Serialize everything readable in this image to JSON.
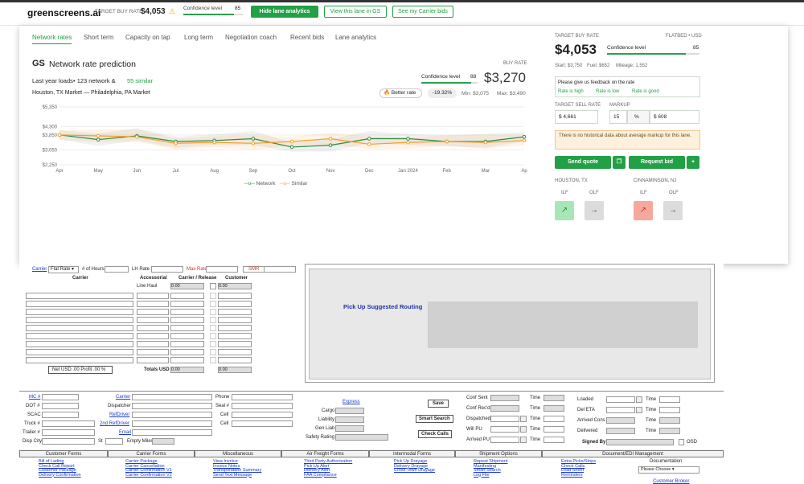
{
  "topbar": {
    "logo": "greenscreens.ai",
    "target_buy_rate_label": "TARGET BUY RATE",
    "target_buy_rate": "$4,053",
    "confidence_label": "Confidence level",
    "confidence": "85",
    "hide_btn": "Hide lane analytics",
    "view_btn": "View this lane in GS",
    "carrier_btn": "See my Carrier bids"
  },
  "tabs": [
    "Network rates",
    "Short term",
    "Capacity on tap",
    "Long term",
    "Negotiation coach",
    "Recent bids",
    "Lane analytics"
  ],
  "prediction": {
    "title": "Network rate prediction",
    "gs": "GS",
    "buy_rate_label": "BUY RATE",
    "last_year": "Last year loads",
    "network_count": "• 123 network &",
    "similar": "55 similar",
    "confidence_label": "Confidence level",
    "confidence": "88",
    "rate": "$3,270",
    "lane": "Houston, TX Market — Philadelphia, PA Market",
    "better_rate": "Better rate",
    "pct": "-19.32%",
    "min": "Min: $3,075",
    "max": "Max: $3,490"
  },
  "chart_data": {
    "type": "line",
    "categories": [
      "Apr",
      "May",
      "Jun",
      "Jul",
      "Aug",
      "Sep",
      "Oct",
      "Nov",
      "Dec",
      "Jan 2024",
      "Feb",
      "Mar",
      "Ap"
    ],
    "yticks": [
      "$5,350",
      "$4,300",
      "$3,850",
      "$3,050",
      "$2,250"
    ],
    "ytick_values": [
      5350,
      4300,
      3850,
      3050,
      2250
    ],
    "ylim": [
      2250,
      5350
    ],
    "series": [
      {
        "name": "Network",
        "color": "#2e8b3f",
        "values": [
          3850,
          3600,
          3800,
          3500,
          3550,
          3650,
          3200,
          3300,
          3650,
          3650,
          3500,
          3500,
          3750
        ]
      },
      {
        "name": "Similar",
        "color": "#f0a030",
        "values": [
          3850,
          3800,
          3750,
          3400,
          3450,
          3400,
          3500,
          3650,
          3350,
          3450,
          3500,
          3450,
          3550
        ]
      }
    ],
    "legend": "bottom"
  },
  "right": {
    "tbr_label": "TARGET BUY RATE",
    "flatbed": "FLATBED • USD",
    "rate": "$4,053",
    "conf_label": "Confidence level",
    "conf": "85",
    "start": "Start: $3,750",
    "fuel": "Fuel: $652",
    "mileage": "Mileage: 1,552",
    "feedback": "Please give us feedback on the rate",
    "high": "Rate is high",
    "low": "Rate is low",
    "good": "Rate is good",
    "tsr_label": "TARGET SELL RATE",
    "markup_label": "MARKUP",
    "tsr": "$ 4,661",
    "markup": "15",
    "pct": "%",
    "markup_amt": "$ 608",
    "notice": "There is no historical data about average markup for this lane.",
    "send_quote": "Send quote",
    "request_bid": "Request bid",
    "plus": "+",
    "origin": "HOUSTON, TX",
    "dest": "CINNAMINSON, NJ",
    "ilf": "ILF",
    "olf": "OLF"
  },
  "legacy": {
    "carrier": "Carrier",
    "flat_rate": "Flat Rate",
    "hours": "# of Hours",
    "lh_rate": "LH Rate",
    "max_rate": "Max Rate",
    "smr": "SMR",
    "col_carrier": "Carrier",
    "col_accessorial": "Accessorial",
    "col_release": "Carrier / Release",
    "col_customer": "Customer",
    "line_haul": "Line Haul",
    "zero": "0.00",
    "net": "Net USD .00    Profit .00 %",
    "totals": "Totals USD",
    "routing": "Pick Up Suggested Routing",
    "left_labels": [
      "MC #",
      "DOT #",
      "SCAC",
      "Truck #",
      "Trailer #",
      "Disp City"
    ],
    "mid_labels": [
      "Carrier",
      "Dispatcher",
      "Email",
      "Cell",
      "Email"
    ],
    "refdriver": "RefDriver",
    "refdriver2": "2nd RefDriver",
    "phone": "Phone",
    "seal": "Seal #",
    "cell": "Cell",
    "st": "St",
    "empty": "Empty Miles",
    "express": "Express",
    "cargo": "Cargo",
    "liability": "Liability",
    "gen_liab": "Gen Liab",
    "safety": "Safety Rating",
    "save": "Save",
    "smart_search": "Smart Search",
    "check_calls": "Check Calls",
    "conf_sent": "Conf Sent",
    "conf_recd": "Conf Rec'd",
    "dispatched": "Dispatched",
    "will_pu": "Will PU",
    "arrived_pu": "Arrived PU",
    "time": "Time",
    "loaded": "Loaded",
    "del_eta": "Del ETA",
    "arrived_cons": "Arrived Cons",
    "delivered": "Delivered",
    "signed": "Signed By",
    "osd": "OSD",
    "sections": [
      "Customer Forms",
      "Carrier Forms",
      "Miscellaneous",
      "Air Freight Forms",
      "Intermodal Forms",
      "Shipment Options",
      "Document/EDI Management"
    ],
    "customer_forms": [
      "Bill of Lading",
      "Check Call Report",
      "Customer Package",
      "Delivery Confirmation"
    ],
    "carrier_forms": [
      "Carrier Package",
      "Carrier Cancellation",
      "Carrier Confirmation V1",
      "Carrier Confirmation V2"
    ],
    "misc": [
      "View Invoice",
      "Invoice Notes",
      "Transportation Summary",
      "Send Text Message"
    ],
    "air": [
      "Third Party Authorization",
      "Pick Up Alert",
      "Delivery Alert",
      "FAA Compliance"
    ],
    "intermodal": [
      "Pick Up Drayage",
      "Delivery Drayage",
      "Cross Town Drayage"
    ],
    "ship1": [
      "Repeat Shipment",
      "Manifesting",
      "Smart Search",
      "Log File"
    ],
    "ship2": [
      "Extra Picks/Stops",
      "Check Calls",
      "Load Sheet",
      "Reminders"
    ],
    "documentation": "Documentation",
    "please_choose": "Please Choose",
    "customer_broker": "Customer Broker"
  }
}
